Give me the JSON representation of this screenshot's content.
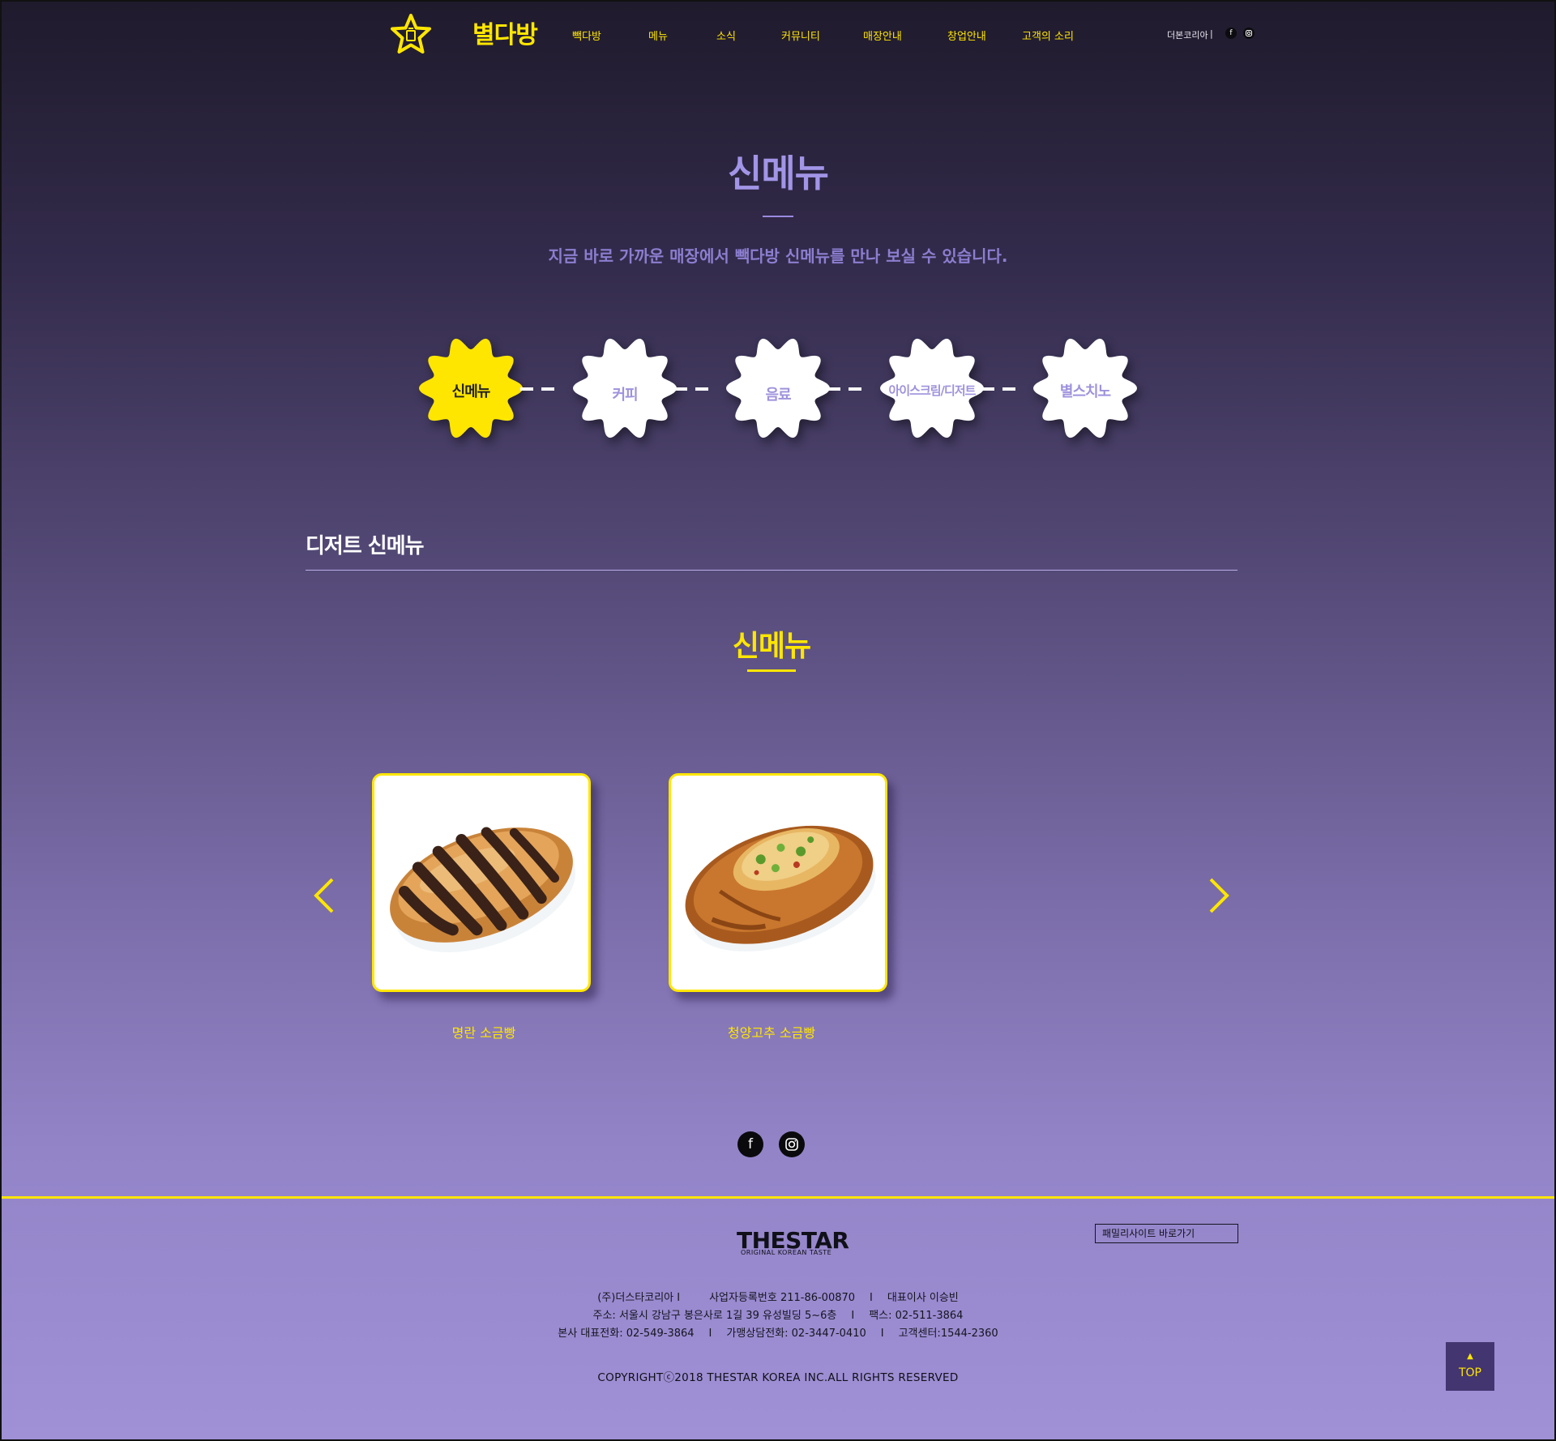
{
  "header": {
    "brand": "별다방",
    "nav": [
      "빽다방",
      "메뉴",
      "소식",
      "커뮤니티",
      "매장안내",
      "창업안내",
      "고객의 소리"
    ],
    "util_text": "더본코리아",
    "util_sep": "|",
    "sns": [
      {
        "icon": "facebook-icon",
        "label": "f"
      },
      {
        "icon": "instagram-icon",
        "label": ""
      }
    ]
  },
  "hero": {
    "title": "신메뉴",
    "subtitle": "지금 바로 가까운 매장에서 빽다방 신메뉴를 만나 보실 수 있습니다."
  },
  "categories": [
    {
      "label": "신메뉴",
      "active": true
    },
    {
      "label": "커피",
      "active": false
    },
    {
      "label": "음료",
      "active": false
    },
    {
      "label": "아이스크림/디저트",
      "active": false
    },
    {
      "label": "별스치노",
      "active": false
    }
  ],
  "section": {
    "title": "디저트 신메뉴",
    "subtitle": "신메뉴"
  },
  "products": [
    {
      "name": "명란 소금빵",
      "image": "bread-chocolate"
    },
    {
      "name": "청양고추 소금빵",
      "image": "bread-pepper"
    }
  ],
  "social_big": [
    {
      "icon": "facebook-icon",
      "label": "f"
    },
    {
      "icon": "instagram-icon",
      "label": ""
    }
  ],
  "footer": {
    "brand": "THESTAR",
    "tagline": "ORIGINAL KOREAN TASTE",
    "family_site": "패밀리사이트 바로가기",
    "line1": [
      "(주)더스타코리아 I",
      "사업자등록번호 211-86-00870",
      "대표이사 이승빈"
    ],
    "line2": [
      "주소: 서울시 강남구 봉은사로 1길 39 유성빌딩 5~6층",
      "팩스: 02-511-3864"
    ],
    "line3": [
      "본사 대표전화: 02-549-3864",
      "가맹상담전화: 02-3447-0410",
      "고객센터:1544-2360"
    ],
    "copyright": "COPYRIGHTⓒ2018 THESTAR KOREA INC.ALL RIGHTS RESERVED",
    "top_arrow": "▲",
    "top_label": "TOP"
  },
  "colors": {
    "accent": "#ffe600",
    "title_purple": "#a294e6",
    "top_button": "#43356f"
  }
}
